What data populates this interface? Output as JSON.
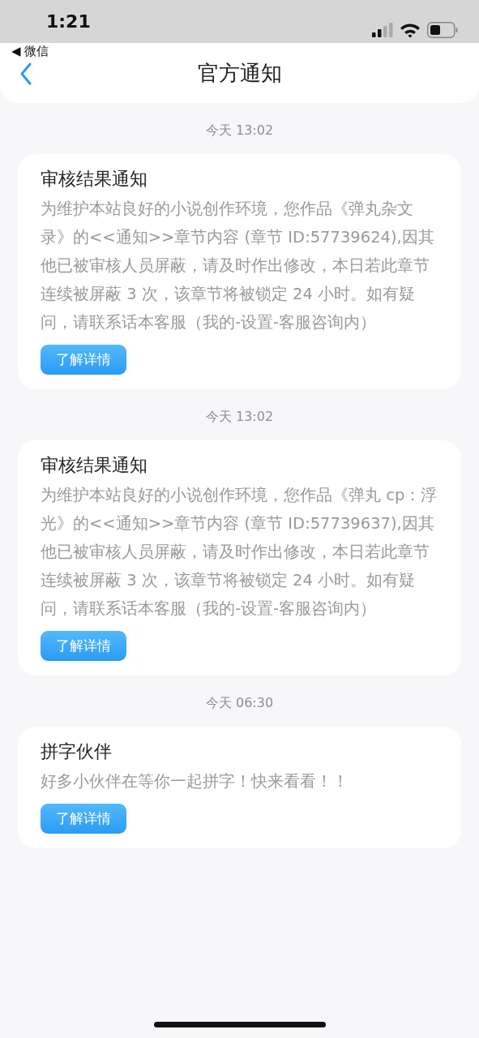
{
  "status_bar": {
    "time": "1:21",
    "back_app": "◀ 微信"
  },
  "nav": {
    "title": "官方通知"
  },
  "messages": [
    {
      "time": "今天 13:02",
      "title": "审核结果通知",
      "body": "为维护本站良好的小说创作环境，您作品《弹丸杂文录》的<<通知>>章节内容 (章节 ID:57739624),因其他已被审核人员屏蔽，请及时作出修改，本日若此章节连续被屏蔽 3 次，该章节将被锁定 24 小时。如有疑问，请联系话本客服（我的-设置-客服咨询内）",
      "button": "了解详情"
    },
    {
      "time": "今天 13:02",
      "title": "审核结果通知",
      "body": "为维护本站良好的小说创作环境，您作品《弹丸 cp：浮光》的<<通知>>章节内容 (章节 ID:57739637),因其他已被审核人员屏蔽，请及时作出修改，本日若此章节连续被屏蔽 3 次，该章节将被锁定 24 小时。如有疑问，请联系话本客服（我的-设置-客服咨询内）",
      "button": "了解详情"
    },
    {
      "time": "今天 06:30",
      "title": "拼字伙伴",
      "body": "好多小伙伴在等你一起拼字！快来看看！！",
      "button": "了解详情"
    }
  ]
}
